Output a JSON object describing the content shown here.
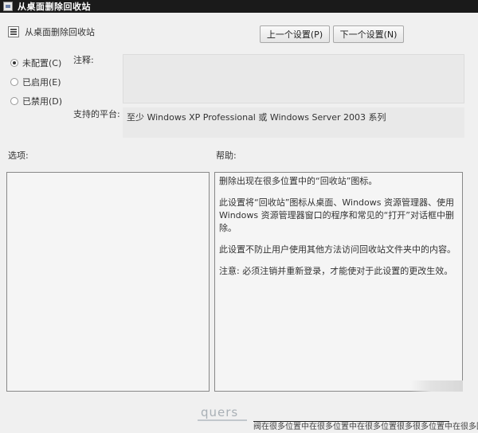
{
  "window": {
    "title": "从桌面删除回收站"
  },
  "header": {
    "policy_name": "从桌面删除回收站",
    "prev_button": "上一个设置(P)",
    "next_button": "下一个设置(N)"
  },
  "state_options": [
    {
      "label": "未配置(C)",
      "selected": true
    },
    {
      "label": "已启用(E)",
      "selected": false
    },
    {
      "label": "已禁用(D)",
      "selected": false
    }
  ],
  "labels": {
    "comment": "注释:",
    "supported_on": "支持的平台:",
    "options": "选项:",
    "help": "帮助:"
  },
  "supported_on_value": "至少 Windows XP Professional 或 Windows Server 2003 系列",
  "help_text": [
    "删除出现在很多位置中的“回收站”图标。",
    "此设置将“回收站”图标从桌面、Windows 资源管理器、使用 Windows 资源管理器窗口的程序和常见的“打开”对话框中删除。",
    "此设置不防止用户使用其他方法访问回收站文件夹中的内容。",
    "注意: 必须注销并重新登录，才能使对于此设置的更改生效。"
  ],
  "watermark": {
    "logo": "quers",
    "strip_text": "阀在很多位置中在很多位置中在很多位置很多很多位置中在很多回收站"
  }
}
